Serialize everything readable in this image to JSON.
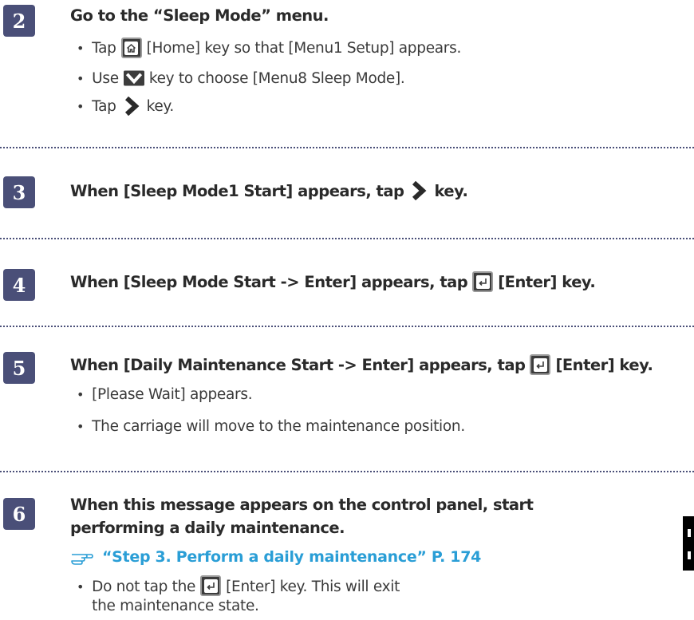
{
  "steps": [
    {
      "number": "2",
      "title": "Go to the “Sleep Mode” menu.",
      "bullets": [
        {
          "before": "Tap",
          "icon": "home-icon",
          "after": "[Home] key so that [Menu1 Setup] appears."
        },
        {
          "before": "Use",
          "icon": "down-arrow-icon",
          "after": "key to choose [Menu8 Sleep Mode]."
        },
        {
          "before": "Tap",
          "icon": "right-arrow-icon",
          "after": "key."
        }
      ]
    },
    {
      "number": "3",
      "title_before": "When [Sleep Mode1 Start] appears, tap",
      "title_icon": "right-arrow-icon",
      "title_after": "key."
    },
    {
      "number": "4",
      "title_before": "When [Sleep Mode Start -> Enter] appears, tap",
      "title_icon": "enter-icon",
      "title_after": "[Enter] key."
    },
    {
      "number": "5",
      "title_before": "When [Daily Maintenance Start -> Enter] appears, tap",
      "title_icon": "enter-icon",
      "title_after": "[Enter] key.",
      "bullets": [
        "[Please Wait] appears.",
        "The carriage will move to the maintenance position."
      ]
    },
    {
      "number": "6",
      "title": "When this message appears on the control panel, start performing a daily maintenance.",
      "reference": {
        "icon": "pointing-hand-icon",
        "text": "“Step 3. Perform a daily maintenance” P. 174"
      },
      "bullets": [
        {
          "before": "Do not tap the",
          "icon": "enter-icon",
          "after": "[Enter] key. This will exit the maintenance state."
        }
      ]
    }
  ],
  "colors": {
    "step_badge": "#4a4f78",
    "link": "#2a9ed6",
    "divider": "#4a4f78",
    "text": "#2a2a2a"
  }
}
